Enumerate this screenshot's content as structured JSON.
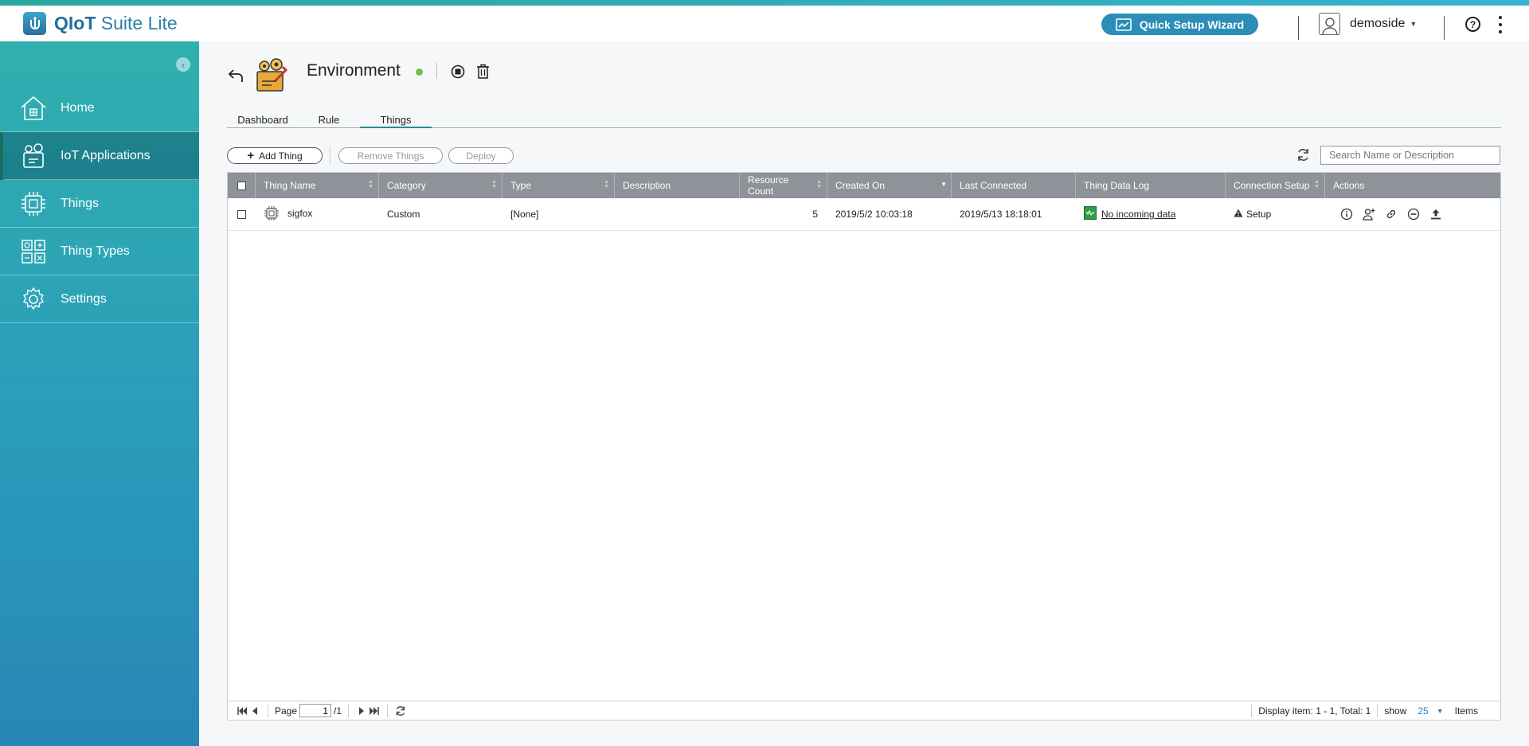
{
  "app": {
    "brand_bold": "QIoT",
    "brand_rest": " Suite Lite"
  },
  "header": {
    "wizard_label": "Quick Setup Wizard",
    "user_name": "demoside",
    "help_label": "?"
  },
  "sidebar": {
    "items": [
      {
        "label": "Home",
        "icon": "home-icon"
      },
      {
        "label": "IoT Applications",
        "icon": "iot-applications-icon",
        "active": true
      },
      {
        "label": "Things",
        "icon": "chip-icon"
      },
      {
        "label": "Thing Types",
        "icon": "thing-types-icon"
      },
      {
        "label": "Settings",
        "icon": "gear-icon"
      }
    ]
  },
  "page": {
    "title": "Environment",
    "status_color": "#6cc24a"
  },
  "tabs": [
    {
      "label": "Dashboard"
    },
    {
      "label": "Rule"
    },
    {
      "label": "Things",
      "active": true
    }
  ],
  "toolbar": {
    "add_label": "Add Thing",
    "remove_label": "Remove Things",
    "deploy_label": "Deploy",
    "search_placeholder": "Search Name or Description"
  },
  "table": {
    "columns": [
      "Thing Name",
      "Category",
      "Type",
      "Description",
      "Resource Count",
      "Created On",
      "Last Connected",
      "Thing Data Log",
      "Connection Setup",
      "Actions"
    ],
    "rows": [
      {
        "name": "sigfox",
        "category": "Custom",
        "type": "[None]",
        "description": "",
        "resource_count": "5",
        "created_on": "2019/5/2 10:03:18",
        "last_connected": "2019/5/13 18:18:01",
        "data_log": "No incoming data",
        "connection_setup": "Setup"
      }
    ]
  },
  "pagination": {
    "page_label": "Page",
    "page_value": "1",
    "total_pages": "/1",
    "display_info": "Display item: 1 - 1, Total: 1",
    "show_label": "show",
    "per_page": "25",
    "items_label": "Items"
  },
  "colors": {
    "sidebar_top": "#2fb0ae",
    "sidebar_bottom": "#2886b5",
    "accent": "#2b8db8",
    "header_bar": "#8d9398"
  }
}
